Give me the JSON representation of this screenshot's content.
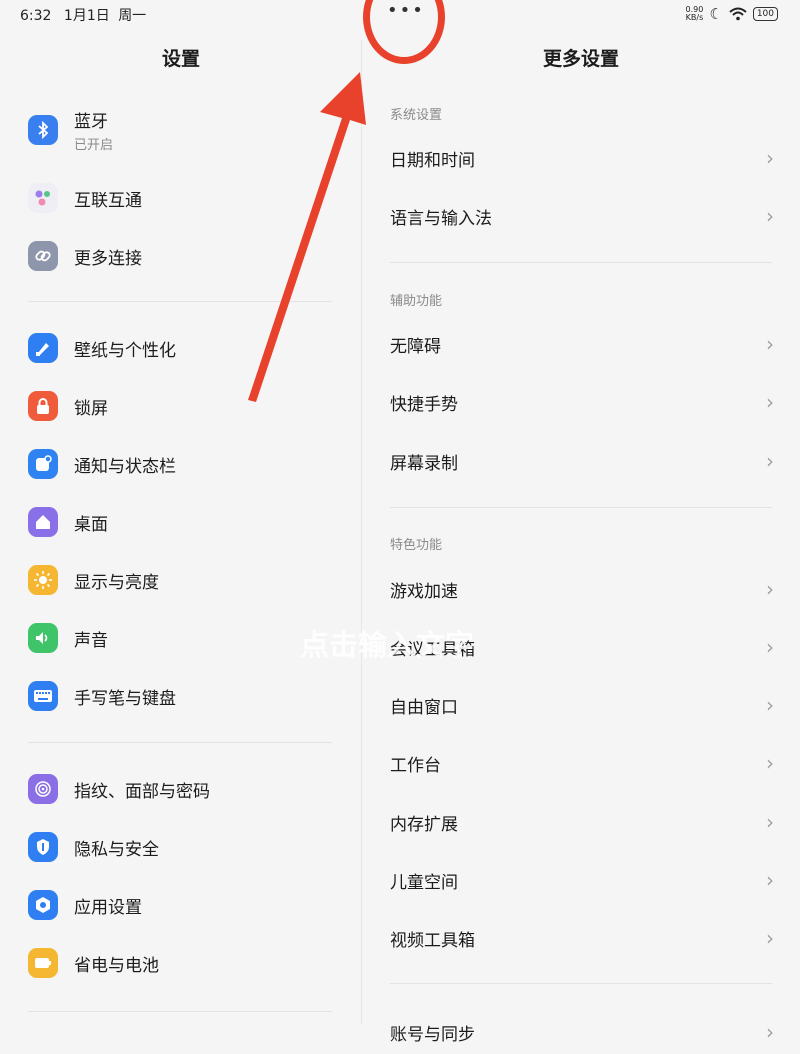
{
  "status": {
    "time": "6:32",
    "date": "1月1日",
    "weekday": "周一",
    "net_speed_value": "0.90",
    "net_speed_unit": "KB/s",
    "battery": "100"
  },
  "left": {
    "title": "设置",
    "groups": [
      [
        {
          "label": "蓝牙",
          "sublabel": "已开启",
          "icon": "bluetooth-icon",
          "color": "#3a7ff0"
        },
        {
          "label": "互联互通",
          "icon": "connect-icon",
          "color": "#f0eef5"
        },
        {
          "label": "更多连接",
          "icon": "link-icon",
          "color": "#8e96ab"
        }
      ],
      [
        {
          "label": "壁纸与个性化",
          "icon": "brush-icon",
          "color": "#2f7ef2"
        },
        {
          "label": "锁屏",
          "icon": "lock-icon",
          "color": "#f05b3c"
        },
        {
          "label": "通知与状态栏",
          "icon": "notification-icon",
          "color": "#2f82f2"
        },
        {
          "label": "桌面",
          "icon": "home-icon",
          "color": "#8a70e8"
        },
        {
          "label": "显示与亮度",
          "icon": "sun-icon",
          "color": "#f5b631"
        },
        {
          "label": "声音",
          "icon": "speaker-icon",
          "color": "#3fc46a"
        },
        {
          "label": "手写笔与键盘",
          "icon": "keyboard-icon",
          "color": "#2f7ef2"
        }
      ],
      [
        {
          "label": "指纹、面部与密码",
          "icon": "fingerprint-icon",
          "color": "#8a6ee6"
        },
        {
          "label": "隐私与安全",
          "icon": "shield-icon",
          "color": "#2f7ef2"
        },
        {
          "label": "应用设置",
          "icon": "app-settings-icon",
          "color": "#2f7ef2"
        },
        {
          "label": "省电与电池",
          "icon": "battery-icon",
          "color": "#f5b631"
        }
      ]
    ]
  },
  "right": {
    "title": "更多设置",
    "sections": [
      {
        "header": "系统设置",
        "items": [
          "日期和时间",
          "语言与输入法"
        ]
      },
      {
        "header": "辅助功能",
        "items": [
          "无障碍",
          "快捷手势",
          "屏幕录制"
        ]
      },
      {
        "header": "特色功能",
        "items": [
          "游戏加速",
          "会议工具箱",
          "自由窗口",
          "工作台",
          "内存扩展",
          "儿童空间",
          "视频工具箱"
        ]
      }
    ],
    "partial_item": "账号与同步"
  },
  "annotation": {
    "watermark": "点击输入文字",
    "arrow_color": "#e8412c"
  }
}
